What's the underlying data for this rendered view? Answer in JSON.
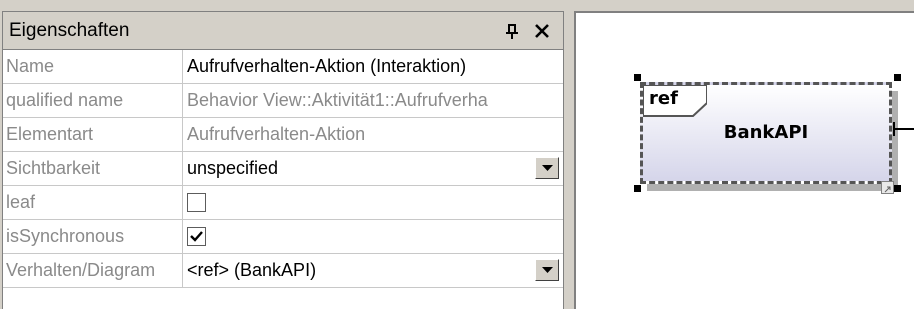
{
  "panel": {
    "title": "Eigenschaften",
    "pin_icon": "pin-icon",
    "close_icon": "close-icon"
  },
  "properties": [
    {
      "key": "Name",
      "value": "Aufrufverhalten-Aktion (Interaktion)"
    },
    {
      "key": "qualified name",
      "value": "Behavior View::Aktivität1::Aufrufverha"
    },
    {
      "key": "Elementart",
      "value": "Aufrufverhalten-Aktion"
    },
    {
      "key": "Sichtbarkeit",
      "value": "unspecified"
    },
    {
      "key": "leaf",
      "value": false
    },
    {
      "key": "isSynchronous",
      "value": true
    },
    {
      "key": "Verhalten/Diagram",
      "value": "<ref> (BankAPI)"
    }
  ],
  "diagram": {
    "ref_label": "ref",
    "fragment_name": "BankAPI"
  },
  "colors": {
    "panel_bg": "#d4d0c8",
    "fragment_gradient_end": "#d5d5ea",
    "muted_text": "#8a8a8a"
  }
}
